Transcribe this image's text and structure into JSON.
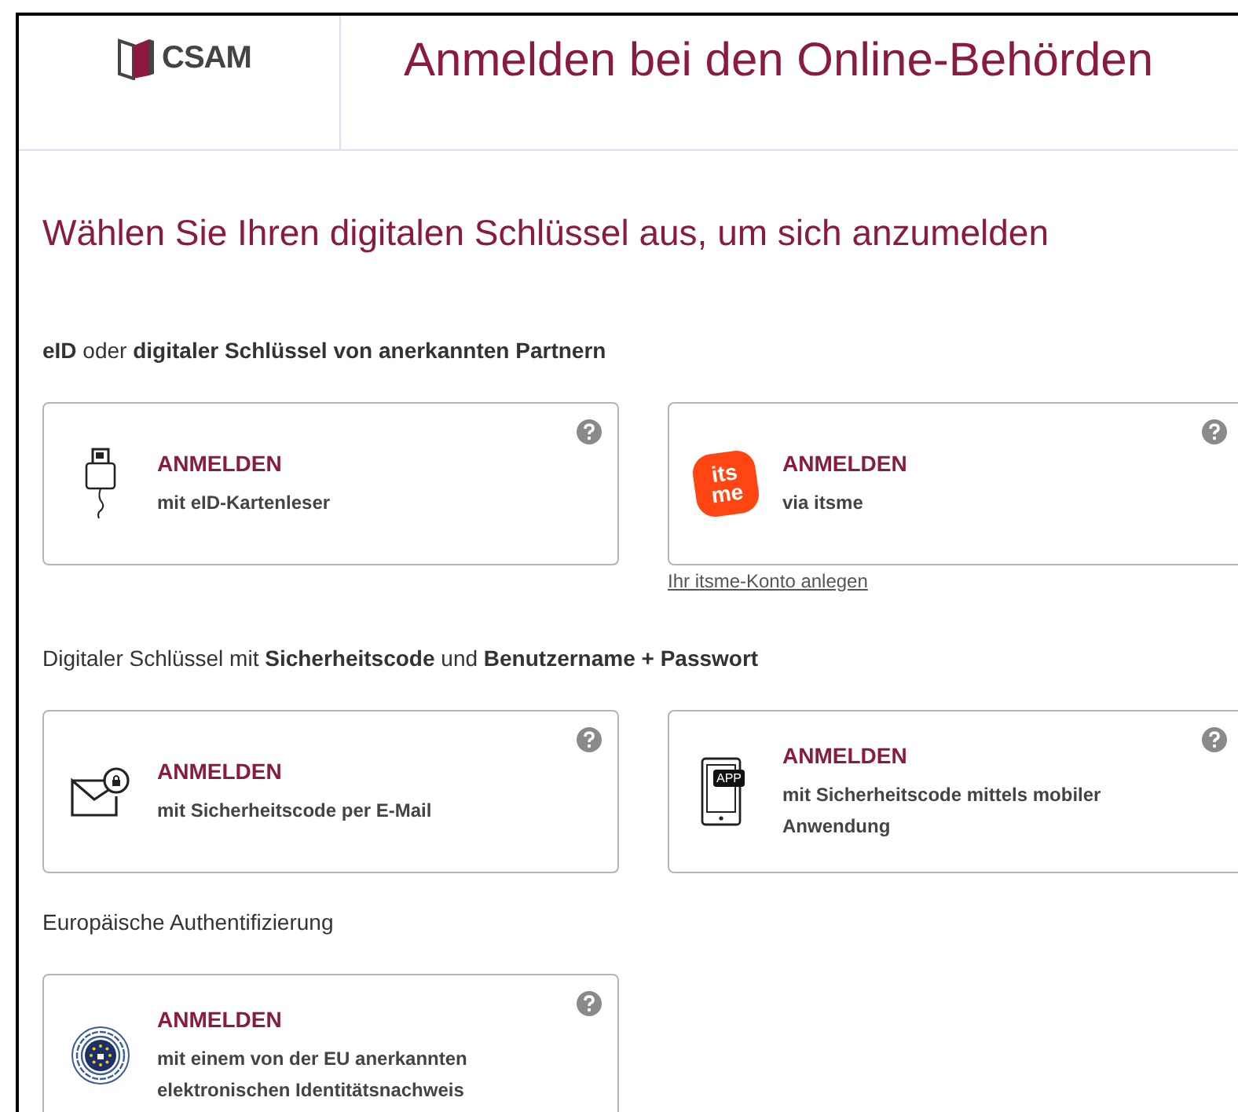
{
  "header": {
    "logo_text": "CSAM",
    "title": "Anmelden bei den Online-Behörden"
  },
  "heading": "Wählen Sie Ihren digitalen Schlüssel aus, um sich anzumelden",
  "sections": [
    {
      "title": "**eID** oder **digitaler Schlüssel von anerkannten Partnern**",
      "cards": [
        {
          "kind": "card-reader",
          "action": "ANMELDEN",
          "description": "mit eID-Kartenleser"
        },
        {
          "kind": "itsme",
          "logo_lines": [
            "its",
            "me"
          ],
          "action": "ANMELDEN",
          "description": "via itsme",
          "link": "Ihr itsme-Konto anlegen"
        }
      ]
    },
    {
      "title": "Digitaler Schlüssel mit **Sicherheitscode** und **Benutzername + Passwort**",
      "cards": [
        {
          "kind": "email",
          "action": "ANMELDEN",
          "description": "mit Sicherheitscode per E-Mail"
        },
        {
          "kind": "app",
          "icon_label": "APP",
          "action": "ANMELDEN",
          "description": "mit Sicherheitscode mittels mobiler Anwendung"
        }
      ]
    },
    {
      "title": "Europäische Authentifizierung",
      "cards": [
        {
          "kind": "eu",
          "action": "ANMELDEN",
          "description": "mit einem von der EU anerkannten elektronischen Identitätsnachweis"
        }
      ]
    }
  ]
}
